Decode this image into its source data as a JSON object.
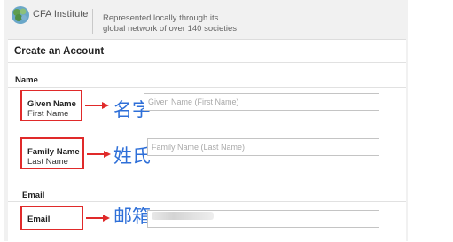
{
  "header": {
    "logo_text": "CFA Institute",
    "tagline_line1": "Represented locally through its",
    "tagline_line2": "global network of over 140 societies"
  },
  "form": {
    "title": "Create an Account",
    "name_section": "Name",
    "given_name": {
      "label": "Given Name",
      "sublabel": "First Name",
      "annotation": "名字",
      "placeholder": "Given Name (First Name)"
    },
    "family_name": {
      "label": "Family Name",
      "sublabel": "Last Name",
      "annotation": "姓氏",
      "placeholder": "Family Name (Last Name)"
    },
    "email_section": "Email",
    "email": {
      "label": "Email",
      "annotation": "邮箱",
      "placeholder": ""
    }
  },
  "colors": {
    "annotation_red": "#e02a2a",
    "annotation_blue": "#2e6fd8",
    "panel_bg": "#f1f1f1"
  }
}
